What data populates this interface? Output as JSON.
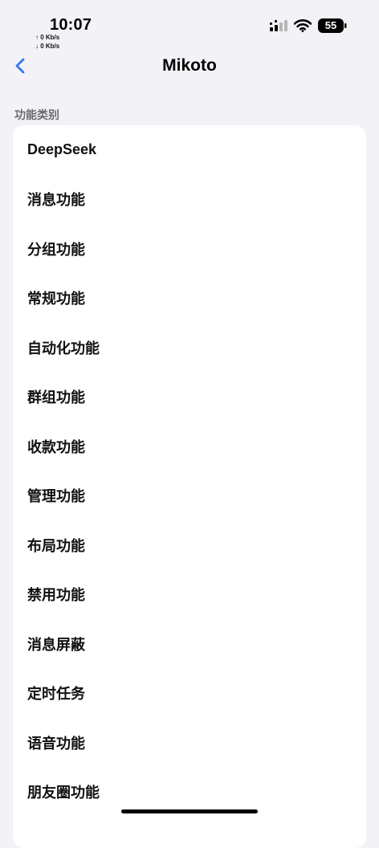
{
  "status_bar": {
    "time": "10:07",
    "upload_speed": "↑ 0 Kb/s",
    "download_speed": "↓ 0 Kb/s",
    "battery_level": "55"
  },
  "nav": {
    "title": "Mikoto",
    "back_icon": "chevron-left-icon",
    "accent_color": "#3478f6"
  },
  "section": {
    "header": "功能类别"
  },
  "items": [
    {
      "label": "DeepSeek"
    },
    {
      "label": "消息功能"
    },
    {
      "label": "分组功能"
    },
    {
      "label": "常规功能"
    },
    {
      "label": "自动化功能"
    },
    {
      "label": "群组功能"
    },
    {
      "label": "收款功能"
    },
    {
      "label": "管理功能"
    },
    {
      "label": "布局功能"
    },
    {
      "label": "禁用功能"
    },
    {
      "label": "消息屏蔽"
    },
    {
      "label": "定时任务"
    },
    {
      "label": "语音功能"
    },
    {
      "label": "朋友圈功能"
    }
  ]
}
